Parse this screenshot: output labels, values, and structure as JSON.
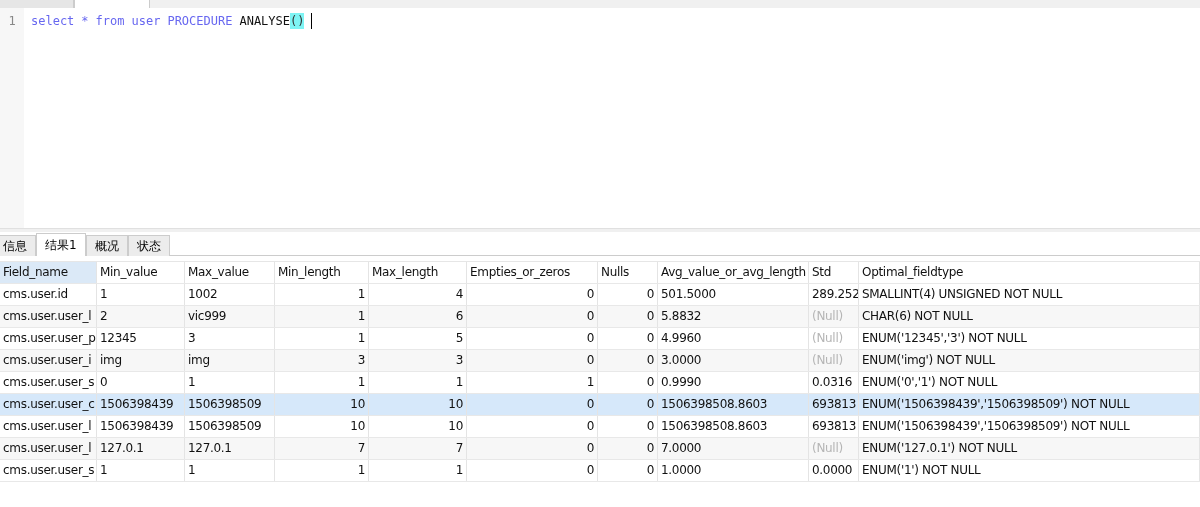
{
  "editor": {
    "line_numbers": [
      "1"
    ],
    "tokens": [
      {
        "text": "select",
        "kind": "keyword"
      },
      {
        "text": "*",
        "kind": "keyword"
      },
      {
        "text": "from",
        "kind": "keyword"
      },
      {
        "text": "user",
        "kind": "keyword"
      },
      {
        "text": "PROCEDURE",
        "kind": "keyword"
      },
      {
        "text": "ANALYSE",
        "kind": "plain",
        "space_after": false
      },
      {
        "text": "()",
        "kind": "match"
      }
    ]
  },
  "result_tabs": [
    {
      "label": "信息",
      "selected": false
    },
    {
      "label": "结果1",
      "selected": true
    },
    {
      "label": "概况",
      "selected": false
    },
    {
      "label": "状态",
      "selected": false
    }
  ],
  "table": {
    "columns": [
      {
        "label": "Field_name",
        "kind": "text",
        "selected": true
      },
      {
        "label": "Min_value",
        "kind": "text",
        "selected": false
      },
      {
        "label": "Max_value",
        "kind": "text",
        "selected": false
      },
      {
        "label": "Min_length",
        "kind": "number",
        "selected": false
      },
      {
        "label": "Max_length",
        "kind": "number",
        "selected": false
      },
      {
        "label": "Empties_or_zeros",
        "kind": "number",
        "selected": false
      },
      {
        "label": "Nulls",
        "kind": "number",
        "selected": false
      },
      {
        "label": "Avg_value_or_avg_length",
        "kind": "text",
        "selected": false
      },
      {
        "label": "Std",
        "kind": "text",
        "selected": false
      },
      {
        "label": "Optimal_fieldtype",
        "kind": "text",
        "selected": false
      }
    ],
    "rows": [
      {
        "selected": false,
        "std_null": false,
        "cells": [
          "cms.user.id",
          "1",
          "1002",
          "1",
          "4",
          "0",
          "0",
          "501.5000",
          "289.252",
          "SMALLINT(4) UNSIGNED NOT NULL"
        ]
      },
      {
        "selected": false,
        "std_null": true,
        "cells": [
          "cms.user.user_l",
          "2",
          "vic999",
          "1",
          "6",
          "0",
          "0",
          "5.8832",
          "(Null)",
          "CHAR(6) NOT NULL"
        ]
      },
      {
        "selected": false,
        "std_null": true,
        "cells": [
          "cms.user.user_p",
          "12345",
          "3",
          "1",
          "5",
          "0",
          "0",
          "4.9960",
          "(Null)",
          "ENUM('12345','3') NOT NULL"
        ]
      },
      {
        "selected": false,
        "std_null": true,
        "cells": [
          "cms.user.user_i",
          "img",
          "img",
          "3",
          "3",
          "0",
          "0",
          "3.0000",
          "(Null)",
          "ENUM('img') NOT NULL"
        ]
      },
      {
        "selected": false,
        "std_null": false,
        "cells": [
          "cms.user.user_s",
          "0",
          "1",
          "1",
          "1",
          "1",
          "0",
          "0.9990",
          "0.0316",
          "ENUM('0','1') NOT NULL"
        ]
      },
      {
        "selected": true,
        "std_null": false,
        "cells": [
          "cms.user.user_c",
          "1506398439",
          "1506398509",
          "10",
          "10",
          "0",
          "0",
          "1506398508.8603",
          "693813",
          "ENUM('1506398439','1506398509') NOT NULL"
        ]
      },
      {
        "selected": false,
        "std_null": false,
        "cells": [
          "cms.user.user_l",
          "1506398439",
          "1506398509",
          "10",
          "10",
          "0",
          "0",
          "1506398508.8603",
          "693813",
          "ENUM('1506398439','1506398509') NOT NULL"
        ]
      },
      {
        "selected": false,
        "std_null": true,
        "cells": [
          "cms.user.user_l",
          "127.0.1",
          "127.0.1",
          "7",
          "7",
          "0",
          "0",
          "7.0000",
          "(Null)",
          "ENUM('127.0.1') NOT NULL"
        ]
      },
      {
        "selected": false,
        "std_null": false,
        "cells": [
          "cms.user.user_s",
          "1",
          "1",
          "1",
          "1",
          "0",
          "0",
          "1.0000",
          "0.0000",
          "ENUM('1') NOT NULL"
        ]
      }
    ]
  }
}
